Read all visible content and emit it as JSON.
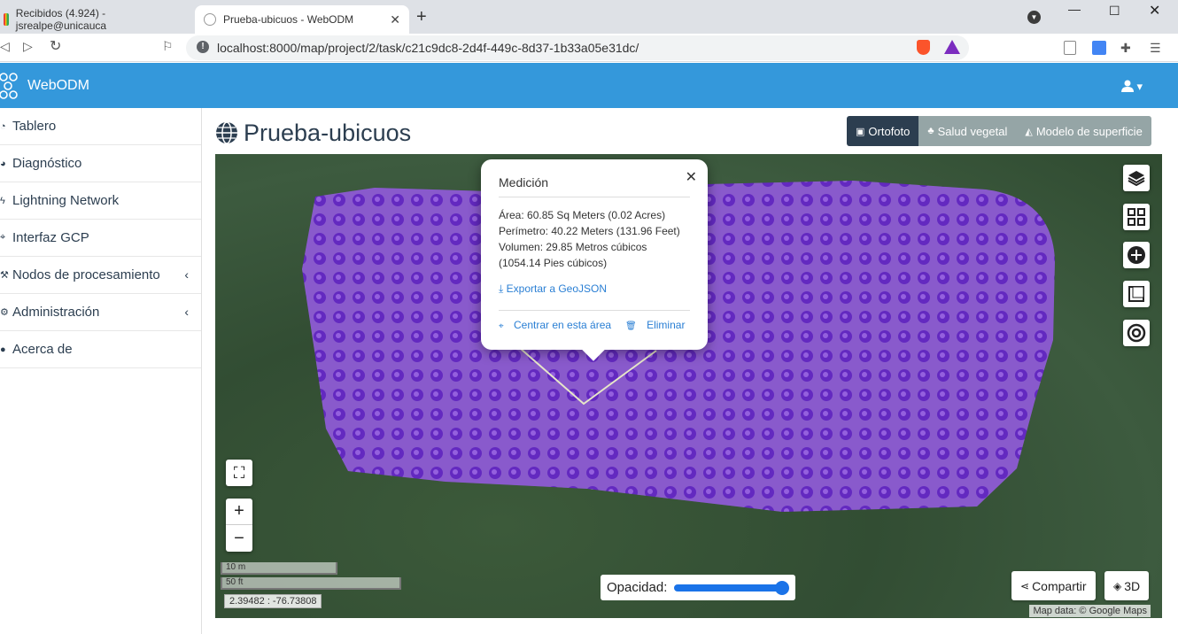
{
  "browser": {
    "tabs": [
      {
        "title": "Recibidos (4.924) - jsrealpe@unicauca",
        "active": false
      },
      {
        "title": "Prueba-ubicuos - WebODM",
        "active": true
      }
    ],
    "url": "localhost:8000/map/project/2/task/c21c9dc8-2d4f-449c-8d37-1b33a05e31dc/"
  },
  "header": {
    "app_name": "WebODM"
  },
  "sidebar": {
    "items": [
      {
        "label": "Tablero"
      },
      {
        "label": "Diagnóstico"
      },
      {
        "label": "Lightning Network"
      },
      {
        "label": "Interfaz GCP"
      },
      {
        "label": "Nodos de procesamiento"
      },
      {
        "label": "Administración"
      },
      {
        "label": "Acerca de"
      }
    ]
  },
  "main": {
    "title": "Prueba-ubicuos",
    "layer_buttons": {
      "ortho": "Ortofoto",
      "plant": "Salud vegetal",
      "dsm": "Modelo de superficie"
    }
  },
  "popup": {
    "title": "Medición",
    "area": "Área: 60.85 Sq Meters (0.02 Acres)",
    "perimeter": "Perímetro: 40.22 Meters (131.96 Feet)",
    "volume": "Volumen: 29.85 Metros cúbicos",
    "volume_ft": "(1054.14 Pies cúbicos)",
    "export": "Exportar a GeoJSON",
    "center": "Centrar en esta área",
    "delete": "Eliminar"
  },
  "map": {
    "scale_m": "10 m",
    "scale_ft": "50 ft",
    "coordinates": "2.39482 : -76.73808",
    "opacity_label": "Opacidad:",
    "opacity_value": 1.0,
    "share": "Compartir",
    "view3d": "3D",
    "attribution": "Map data: © Google Maps"
  },
  "colors": {
    "header": "#3498db",
    "active_layer": "#2c3e50",
    "inactive_layer": "#95a5a6",
    "link": "#2a7fd4",
    "ortho_fill": "#7a3fd6"
  }
}
